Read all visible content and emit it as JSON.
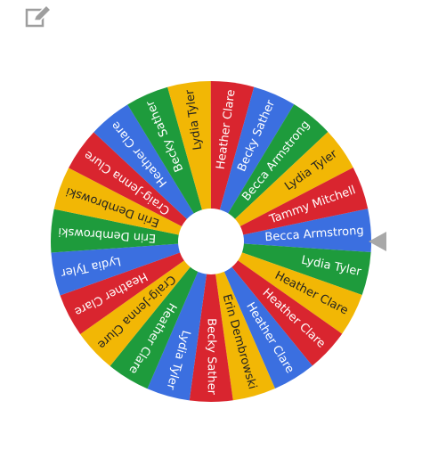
{
  "toolbar": {
    "edit_icon": "edit-icon"
  },
  "pointer_icon": "triangle-left-icon",
  "wheel": {
    "entries": [
      {
        "label": "Becca Armstrong",
        "color": "#3b6fe0"
      },
      {
        "label": "Lydia Tyler",
        "color": "#1e9b3c"
      },
      {
        "label": "Heather Clare",
        "color": "#f2b705"
      },
      {
        "label": "Heather Clare",
        "color": "#d9252f"
      },
      {
        "label": "Heather Clare",
        "color": "#3b6fe0"
      },
      {
        "label": "Erin Dembrowski",
        "color": "#f2b705"
      },
      {
        "label": "Becky Sather",
        "color": "#d9252f"
      },
      {
        "label": "Lydia Tyler",
        "color": "#3b6fe0"
      },
      {
        "label": "Heather Clare",
        "color": "#1e9b3c"
      },
      {
        "label": "Craig-Jenna Clure",
        "color": "#f2b705"
      },
      {
        "label": "Heather Clare",
        "color": "#d9252f"
      },
      {
        "label": "Lydia Tyler",
        "color": "#3b6fe0"
      },
      {
        "label": "Erin Dembrowski",
        "color": "#1e9b3c"
      },
      {
        "label": "Erin Dembrowski",
        "color": "#f2b705"
      },
      {
        "label": "Craig-Jenna Clure",
        "color": "#d9252f"
      },
      {
        "label": "Heather Clare",
        "color": "#3b6fe0"
      },
      {
        "label": "Becky Sather",
        "color": "#1e9b3c"
      },
      {
        "label": "Lydia Tyler",
        "color": "#f2b705"
      },
      {
        "label": "Heather Clare",
        "color": "#d9252f"
      },
      {
        "label": "Becky Sather",
        "color": "#3b6fe0"
      },
      {
        "label": "Becca Armstrong",
        "color": "#1e9b3c"
      },
      {
        "label": "Lydia Tyler",
        "color": "#f2b705"
      },
      {
        "label": "Tammy Mitchell",
        "color": "#d9252f"
      }
    ]
  }
}
